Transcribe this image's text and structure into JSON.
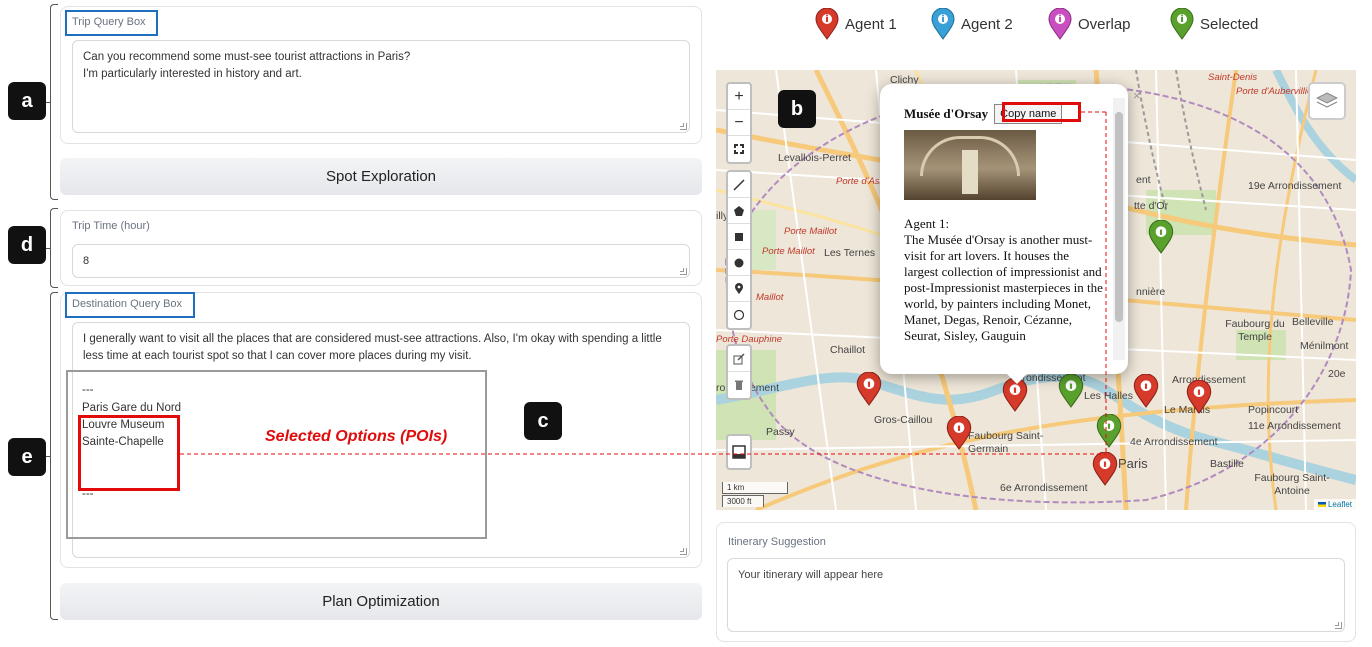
{
  "left": {
    "trip_query": {
      "label": "Trip Query Box",
      "value": "Can you recommend some must-see tourist attractions in Paris?\nI'm particularly interested in history and art."
    },
    "spot_button": "Spot Exploration",
    "trip_time": {
      "label": "Trip Time (hour)",
      "value": "8"
    },
    "destination_query": {
      "label": "Destination Query Box",
      "value": "I generally want to visit all the places that are considered must-see attractions. Also, I'm okay with spending a little less time at each tourist spot so that I can cover more places during my visit."
    },
    "list_sep_top": "---",
    "list_items": [
      "Paris Gare du Nord",
      "Louvre Museum",
      "Sainte-Chapelle"
    ],
    "list_sep_bottom": "---",
    "plan_button": "Plan Optimization"
  },
  "annotations": {
    "a": "a",
    "b": "b",
    "c": "c",
    "d": "d",
    "e": "e",
    "selected_options": "Selected Options (POIs)"
  },
  "legend": [
    {
      "label": "Agent 1",
      "color": "#d63a2a"
    },
    {
      "label": "Agent 2",
      "color": "#3aa0d8"
    },
    {
      "label": "Overlap",
      "color": "#c94fc0"
    },
    {
      "label": "Selected",
      "color": "#5aa02c"
    }
  ],
  "map": {
    "labels": {
      "clichy": "Clichy",
      "saint_denis": "Saint-Denis",
      "aubervilliers": "Seine-Saint-Denis",
      "porte_aubervilliers": "Porte d'Aubervilliers",
      "levallois": "Levallois-Perret",
      "porte_asnieres": "Porte d'Asnières",
      "arr19": "19e Arrondissement",
      "porte_maillot": "Porte Maillot",
      "les_ternes": "Les Ternes",
      "maillot": "Maillot",
      "dauphine": "Porte Dauphine",
      "chaillot": "Chaillot",
      "arr16": "Arrondissement",
      "gros_caillou": "Gros-Caillou",
      "passy": "Passy",
      "faubourg_st_germain": "Faubourg Saint-Germain",
      "arr6": "6e Arrondissement",
      "les_halles": "Les Halles",
      "le_marais": "Le Marais",
      "arr3": "Arrondissement",
      "arr4": "4e Arrondissement",
      "faubourg_temple": "Faubourg du Temple",
      "belleville": "Belleville",
      "menilmont": "Ménilmont",
      "arr20": "20e",
      "popincourt": "Popincourt",
      "arr11": "11e Arrondissement",
      "bastille": "Bastille",
      "faubourg_antoine": "Faubourg Saint-Antoine",
      "paris": "Paris",
      "arr1": "Arrondissement",
      "gare_nord": "nnière",
      "villette": "tte d'Or",
      "ent": "ent",
      "arrondissement_left": "rondissement",
      "illy": "illy"
    },
    "scale_km": "1 km",
    "scale_ft": "3000 ft",
    "attribution": "Leaflet"
  },
  "popup": {
    "title": "Musée d'Orsay",
    "copy_button": "Copy name",
    "agent_label": "Agent 1:",
    "description": "The Musée d'Orsay is another must-visit for art lovers. It houses the largest collection of impressionist and post-Impressionist masterpieces in the world, by painters including Monet, Manet, Degas, Renoir, Cézanne, Seurat, Sisley, Gauguin",
    "close": "×"
  },
  "itinerary": {
    "label": "Itinerary Suggestion",
    "placeholder": "Your itinerary will appear here"
  }
}
